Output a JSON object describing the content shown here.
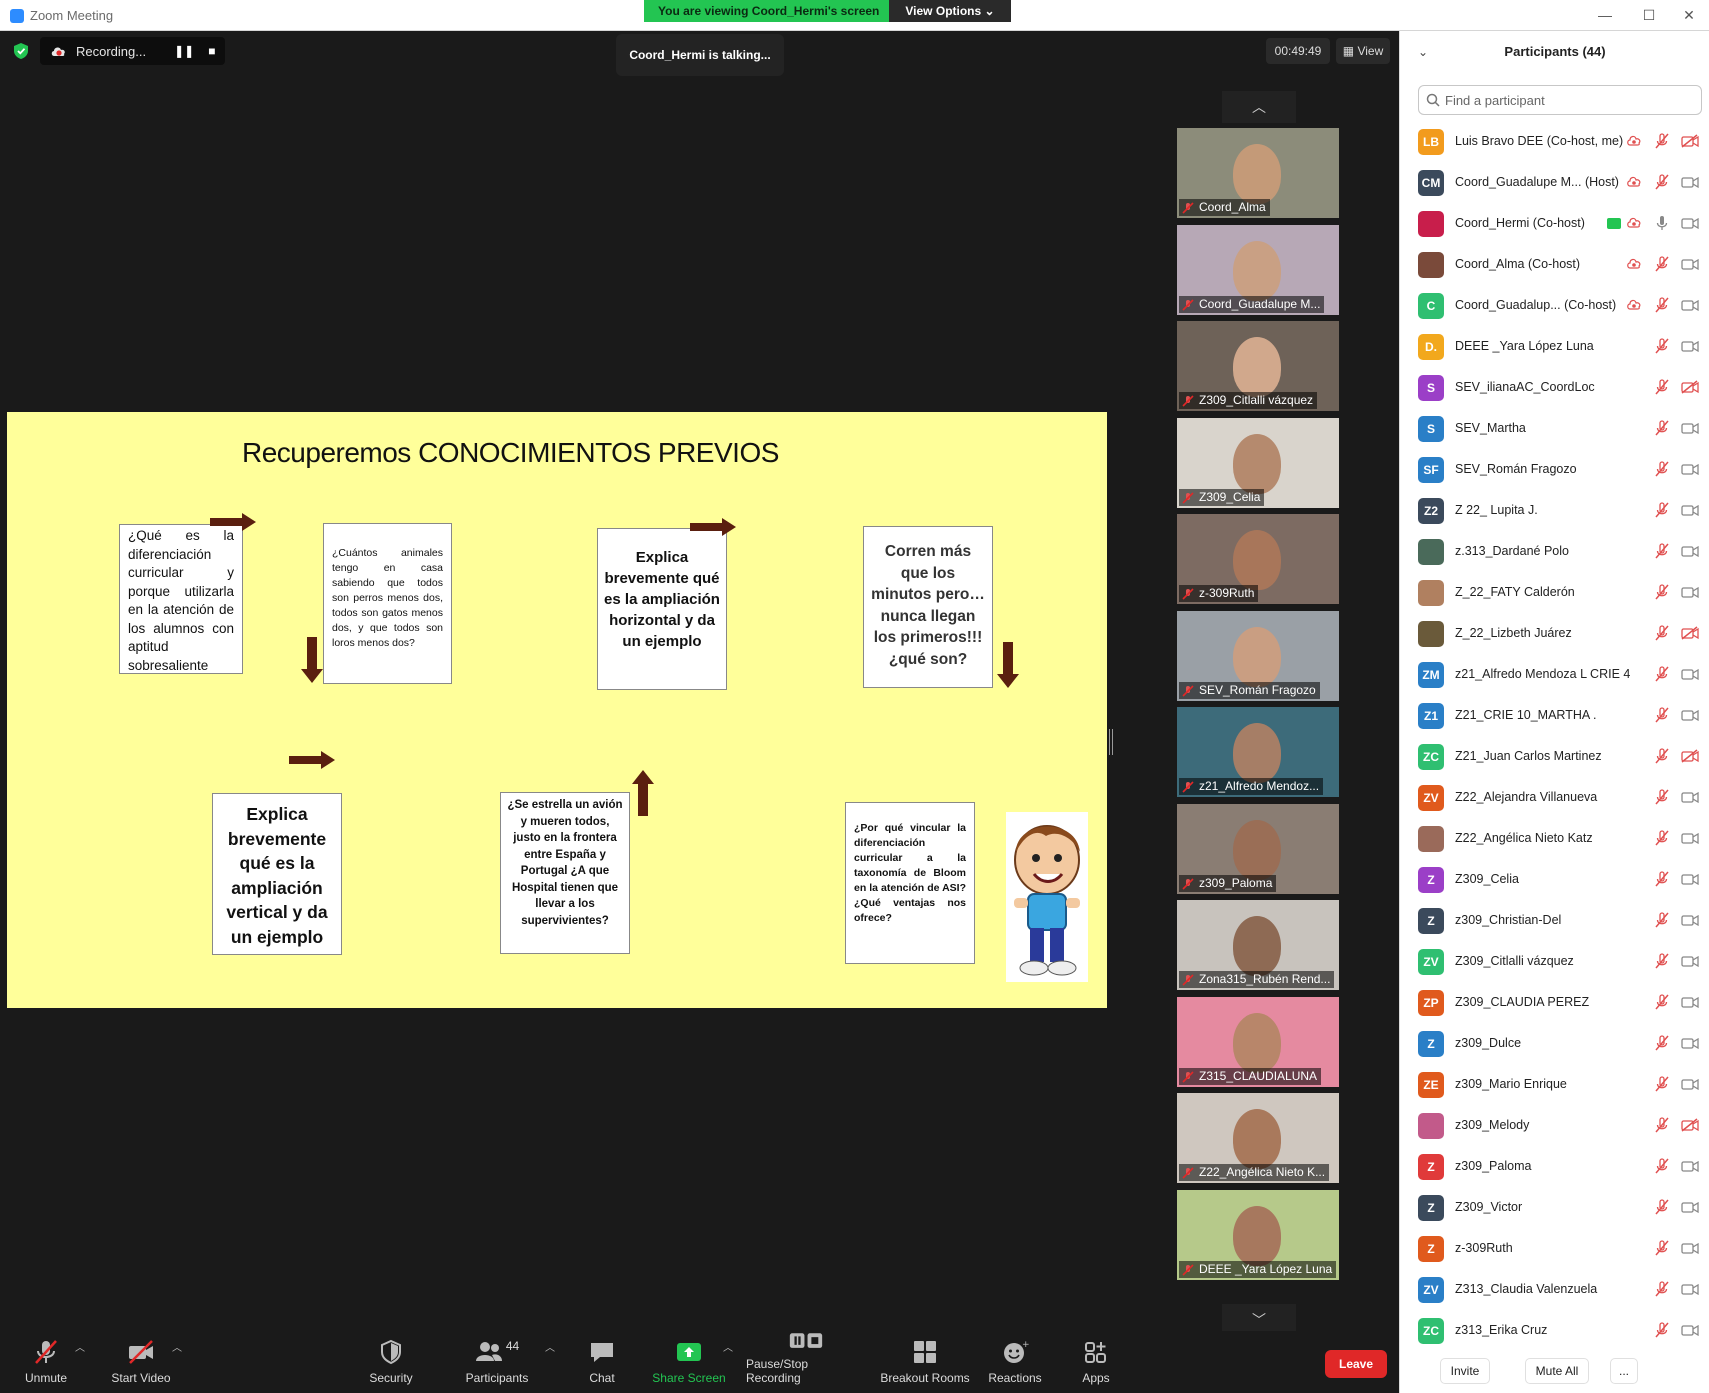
{
  "window": {
    "title": "Zoom Meeting",
    "viewing_banner": "You are viewing Coord_Hermi's screen",
    "view_options": "View Options",
    "controls": [
      "—",
      "☐",
      "✕"
    ]
  },
  "meeting": {
    "recording_label": "Recording...",
    "talking": "Coord_Hermi is talking...",
    "timer": "00:49:49",
    "view_label": "View"
  },
  "slide": {
    "title": "Recuperemos CONOCIMIENTOS PREVIOS",
    "box1": "¿Qué es la diferenciación curricular y porque utilizarla en la atención de los alumnos con aptitud sobresaliente intelectual?",
    "box2": "¿Cuántos animales tengo en casa sabiendo que todos son perros menos dos, todos son gatos menos dos, y que todos son loros menos dos?",
    "box3": "Explica brevemente qué es la ampliación horizontal y da un ejemplo",
    "box4": "Corren más que los minutos pero… nunca llegan los primeros!!! ¿qué son?",
    "box5": "Explica brevemente qué es la ampliación vertical y da un ejemplo",
    "box6": "¿Se estrella un avión y mueren todos, justo en la frontera entre España y Portugal ¿A que Hospital tienen que llevar a los supervivientes?",
    "box7": "¿Por qué vincular la diferenciación curricular a la taxonomía de Bloom en la atención de ASI? ¿Qué ventajas nos ofrece?"
  },
  "thumbnails": [
    {
      "name": "Coord_Alma",
      "bg": "#8c8c7a",
      "face": "#c49a78"
    },
    {
      "name": "Coord_Guadalupe M...",
      "bg": "#b7a8b6",
      "face": "#c9a084"
    },
    {
      "name": "Z309_Citlalli vázquez",
      "bg": "#6e6258",
      "face": "#d1a88c"
    },
    {
      "name": "Z309_Celia",
      "bg": "#d9d4cc",
      "face": "#b58a6e"
    },
    {
      "name": "z-309Ruth",
      "bg": "#7d6b62",
      "face": "#a8765a"
    },
    {
      "name": "SEV_Román Fragozo",
      "bg": "#9aa0a6",
      "face": "#c99e82"
    },
    {
      "name": "z21_Alfredo Mendoz...",
      "bg": "#3d6b7a",
      "face": "#a67e66"
    },
    {
      "name": "z309_Paloma",
      "bg": "#8a7d73",
      "face": "#9a6e56"
    },
    {
      "name": "Zona315_Rubén Rend...",
      "bg": "#c8c3bd",
      "face": "#8e6a54"
    },
    {
      "name": "Z315_CLAUDIALUNA",
      "bg": "#e58aa0",
      "face": "#b8866a"
    },
    {
      "name": "Z22_Angélica Nieto K...",
      "bg": "#cfc7bf",
      "face": "#a9795c"
    },
    {
      "name": "DEEE _Yara López Luna",
      "bg": "#b6c98a",
      "face": "#a7785e"
    }
  ],
  "toolbar": {
    "unmute": "Unmute",
    "start_video": "Start Video",
    "security": "Security",
    "participants": "Participants",
    "participants_count": "44",
    "chat": "Chat",
    "share_screen": "Share Screen",
    "pause_stop": "Pause/Stop Recording",
    "breakout": "Breakout Rooms",
    "reactions": "Reactions",
    "apps": "Apps",
    "leave": "Leave"
  },
  "panel": {
    "title": "Participants (44)",
    "search_placeholder": "Find a participant",
    "invite": "Invite",
    "mute_all": "Mute All",
    "more": "...",
    "participants": [
      {
        "initials": "LB",
        "color": "#f29b1d",
        "name": "Luis Bravo DEE (Co-host, me)",
        "rec": true,
        "share": false,
        "mic": "off",
        "cam": "off"
      },
      {
        "initials": "CM",
        "color": "#3b4a5c",
        "name": "Coord_Guadalupe M... (Host)",
        "rec": true,
        "share": false,
        "mic": "off",
        "cam": "on"
      },
      {
        "initials": "",
        "color": "#c81e4b",
        "name": "Coord_Hermi (Co-host)",
        "rec": true,
        "share": true,
        "mic": "on",
        "cam": "on"
      },
      {
        "initials": "",
        "color": "#7a4a3a",
        "name": "Coord_Alma (Co-host)",
        "rec": true,
        "share": false,
        "mic": "off",
        "cam": "on"
      },
      {
        "initials": "C",
        "color": "#2fbf71",
        "name": "Coord_Guadalup... (Co-host)",
        "rec": true,
        "share": false,
        "mic": "off",
        "cam": "on"
      },
      {
        "initials": "D.",
        "color": "#f2a81d",
        "name": "DEEE _Yara López Luna",
        "rec": false,
        "share": false,
        "mic": "off",
        "cam": "on"
      },
      {
        "initials": "S",
        "color": "#9b3fc7",
        "name": "SEV_ilianaAC_CoordLoc",
        "rec": false,
        "share": false,
        "mic": "off",
        "cam": "off"
      },
      {
        "initials": "S",
        "color": "#2a7fc7",
        "name": "SEV_Martha",
        "rec": false,
        "share": false,
        "mic": "off",
        "cam": "on"
      },
      {
        "initials": "SF",
        "color": "#2a7fc7",
        "name": "SEV_Román Fragozo",
        "rec": false,
        "share": false,
        "mic": "off",
        "cam": "on"
      },
      {
        "initials": "Z2",
        "color": "#3b4a5c",
        "name": "Z 22_ Lupita J.",
        "rec": false,
        "share": false,
        "mic": "off",
        "cam": "on"
      },
      {
        "initials": "",
        "color": "#4a6a5a",
        "name": "z.313_Dardané Polo",
        "rec": false,
        "share": false,
        "mic": "off",
        "cam": "on"
      },
      {
        "initials": "",
        "color": "#b08060",
        "name": "Z_22_FATY Calderón",
        "rec": false,
        "share": false,
        "mic": "off",
        "cam": "on"
      },
      {
        "initials": "",
        "color": "#6a5a3a",
        "name": "Z_22_Lizbeth Juárez",
        "rec": false,
        "share": false,
        "mic": "off",
        "cam": "off"
      },
      {
        "initials": "ZM",
        "color": "#2a7fc7",
        "name": "z21_Alfredo Mendoza L CRIE 4",
        "rec": false,
        "share": false,
        "mic": "off",
        "cam": "on"
      },
      {
        "initials": "Z1",
        "color": "#2a7fc7",
        "name": "Z21_CRIE 10_MARTHA .",
        "rec": false,
        "share": false,
        "mic": "off",
        "cam": "on"
      },
      {
        "initials": "ZC",
        "color": "#2fbf71",
        "name": "Z21_Juan Carlos Martinez",
        "rec": false,
        "share": false,
        "mic": "off",
        "cam": "off"
      },
      {
        "initials": "ZV",
        "color": "#e05a1d",
        "name": "Z22_Alejandra Villanueva",
        "rec": false,
        "share": false,
        "mic": "off",
        "cam": "on"
      },
      {
        "initials": "",
        "color": "#9a6a5a",
        "name": "Z22_Angélica Nieto Katz",
        "rec": false,
        "share": false,
        "mic": "off",
        "cam": "on"
      },
      {
        "initials": "Z",
        "color": "#9b3fc7",
        "name": "Z309_Celia",
        "rec": false,
        "share": false,
        "mic": "off",
        "cam": "on"
      },
      {
        "initials": "Z",
        "color": "#3b4a5c",
        "name": "z309_Christian-Del",
        "rec": false,
        "share": false,
        "mic": "off",
        "cam": "on"
      },
      {
        "initials": "ZV",
        "color": "#2fbf71",
        "name": "Z309_Citlalli vázquez",
        "rec": false,
        "share": false,
        "mic": "off",
        "cam": "on"
      },
      {
        "initials": "ZP",
        "color": "#e05a1d",
        "name": "Z309_CLAUDIA PEREZ",
        "rec": false,
        "share": false,
        "mic": "off",
        "cam": "on"
      },
      {
        "initials": "Z",
        "color": "#2a7fc7",
        "name": "z309_Dulce",
        "rec": false,
        "share": false,
        "mic": "off",
        "cam": "on"
      },
      {
        "initials": "ZE",
        "color": "#e05a1d",
        "name": "z309_Mario Enrique",
        "rec": false,
        "share": false,
        "mic": "off",
        "cam": "on"
      },
      {
        "initials": "",
        "color": "#c25a8a",
        "name": "z309_Melody",
        "rec": false,
        "share": false,
        "mic": "off",
        "cam": "off"
      },
      {
        "initials": "Z",
        "color": "#e03a3a",
        "name": "z309_Paloma",
        "rec": false,
        "share": false,
        "mic": "off",
        "cam": "on"
      },
      {
        "initials": "Z",
        "color": "#3b4a5c",
        "name": "Z309_Victor",
        "rec": false,
        "share": false,
        "mic": "off",
        "cam": "on"
      },
      {
        "initials": "Z",
        "color": "#e05a1d",
        "name": "z-309Ruth",
        "rec": false,
        "share": false,
        "mic": "off",
        "cam": "on"
      },
      {
        "initials": "ZV",
        "color": "#2a7fc7",
        "name": "Z313_Claudia Valenzuela",
        "rec": false,
        "share": false,
        "mic": "off",
        "cam": "on"
      },
      {
        "initials": "ZC",
        "color": "#2fbf71",
        "name": "z313_Erika Cruz",
        "rec": false,
        "share": false,
        "mic": "off",
        "cam": "on"
      }
    ]
  }
}
